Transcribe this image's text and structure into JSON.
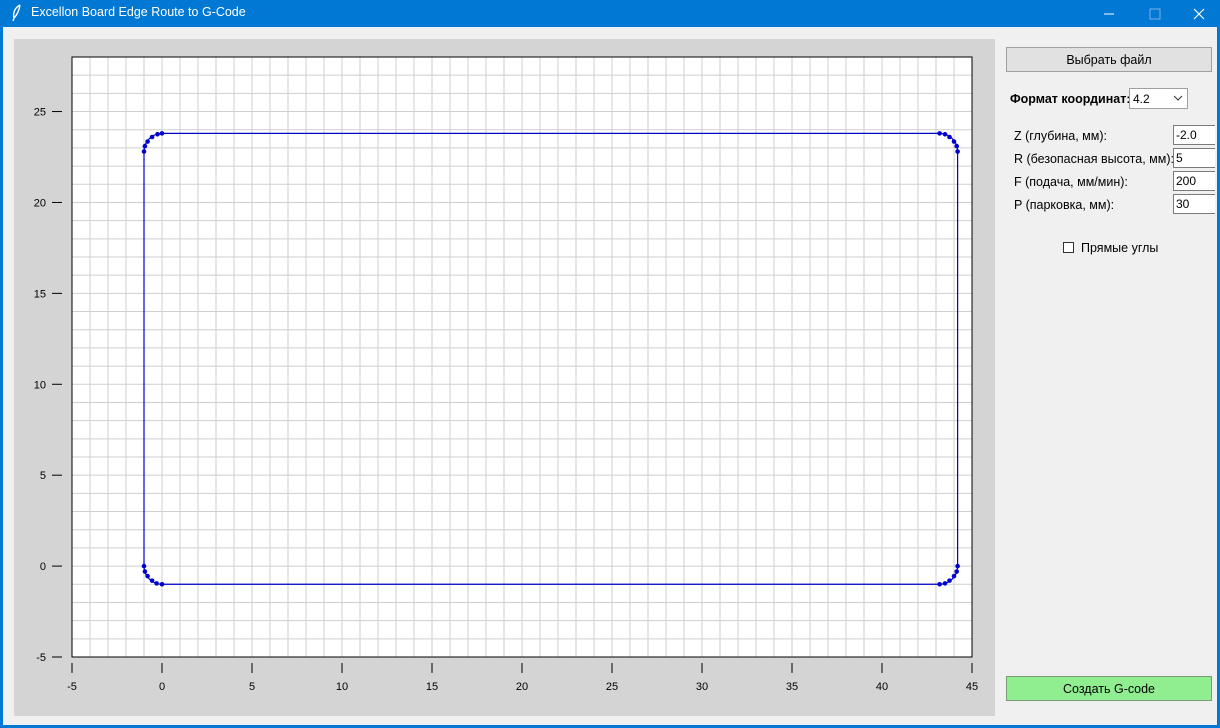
{
  "window": {
    "title": "Excellon Board Edge Route to G-Code",
    "app_icon": "feather-icon",
    "controls": [
      "minimize-icon",
      "maximize-icon",
      "close-icon"
    ]
  },
  "panel": {
    "choose_file_label": "Выбрать файл",
    "coord_format_label": "Формат координат:",
    "coord_format_value": "4.2",
    "params": [
      {
        "label": "Z (глубина, мм):",
        "value": "-2.0"
      },
      {
        "label": "R (безопасная высота, мм):",
        "value": "5"
      },
      {
        "label": "F (подача, мм/мин):",
        "value": "200"
      },
      {
        "label": "P (парковка, мм):",
        "value": "30"
      }
    ],
    "square_corners_label": "Прямые углы",
    "square_corners_checked": false,
    "create_button_label": "Создать G-code",
    "create_button_color": "#90ee90"
  },
  "chart_data": {
    "type": "line",
    "grid": true,
    "xlim": [
      -5,
      45
    ],
    "ylim": [
      -5,
      28
    ],
    "xticks": [
      -5,
      0,
      5,
      10,
      15,
      20,
      25,
      30,
      35,
      40,
      45
    ],
    "yticks": [
      -5,
      0,
      5,
      10,
      15,
      20,
      25
    ],
    "line_color": "#0000cc",
    "outline": {
      "x_min": -1.0,
      "x_max": 44.2,
      "y_min": -1.0,
      "y_max": 23.8,
      "corner_radius": 1.0
    },
    "arc_points": [
      [
        -1.0,
        22.8
      ],
      [
        -0.95,
        23.1
      ],
      [
        -0.8,
        23.35
      ],
      [
        -0.55,
        23.6
      ],
      [
        -0.25,
        23.75
      ],
      [
        0.0,
        23.8
      ],
      [
        43.2,
        23.8
      ],
      [
        43.5,
        23.75
      ],
      [
        43.75,
        23.6
      ],
      [
        44.0,
        23.35
      ],
      [
        44.15,
        23.1
      ],
      [
        44.2,
        22.8
      ],
      [
        44.2,
        0.0
      ],
      [
        44.15,
        -0.3
      ],
      [
        44.0,
        -0.55
      ],
      [
        43.75,
        -0.8
      ],
      [
        43.5,
        -0.95
      ],
      [
        43.2,
        -1.0
      ],
      [
        0.0,
        -1.0
      ],
      [
        -0.3,
        -0.95
      ],
      [
        -0.55,
        -0.8
      ],
      [
        -0.8,
        -0.55
      ],
      [
        -0.95,
        -0.3
      ],
      [
        -1.0,
        0.0
      ]
    ]
  }
}
